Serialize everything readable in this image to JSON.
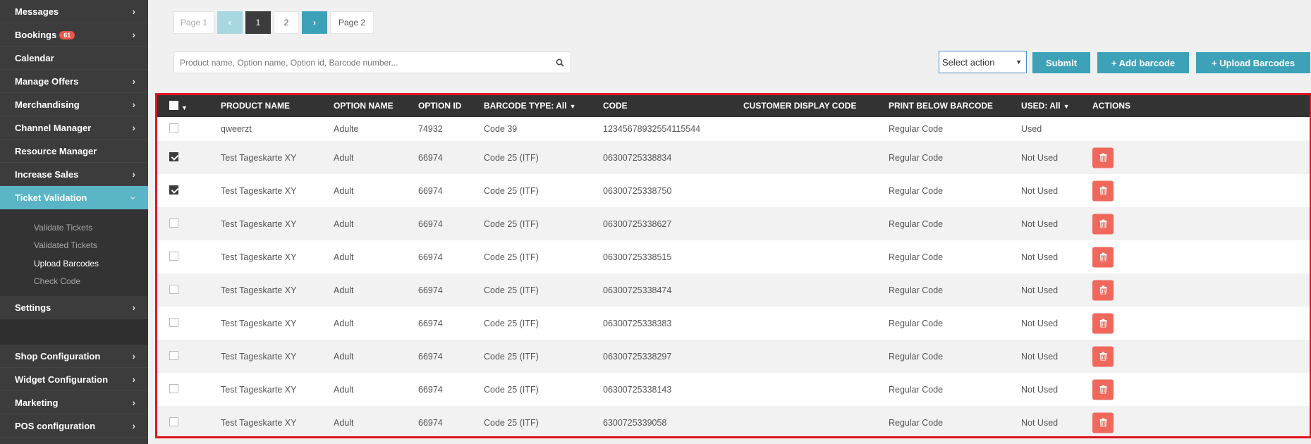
{
  "sidebar": {
    "items_top": [
      {
        "label": "Messages",
        "chevron": true
      },
      {
        "label": "Bookings",
        "badge": "61",
        "chevron": true
      },
      {
        "label": "Calendar",
        "chevron": false
      },
      {
        "label": "Manage Offers",
        "chevron": true
      },
      {
        "label": "Merchandising",
        "chevron": true
      },
      {
        "label": "Channel Manager",
        "chevron": true
      },
      {
        "label": "Resource Manager",
        "chevron": false
      },
      {
        "label": "Increase Sales",
        "chevron": true
      }
    ],
    "active": {
      "label": "Ticket Validation"
    },
    "sub_items": [
      "Validate Tickets",
      "Validated Tickets",
      "Upload Barcodes",
      "Check Code"
    ],
    "settings": {
      "label": "Settings"
    },
    "items_bottom": [
      "Shop Configuration",
      "Widget Configuration",
      "Marketing",
      "POS configuration"
    ]
  },
  "pagination": {
    "first_label": "Page 1",
    "prev": "‹",
    "page1": "1",
    "page2": "2",
    "next": "›",
    "last_label": "Page 2"
  },
  "search": {
    "placeholder": "Product name, Option name, Option id, Barcode number..."
  },
  "toolbar": {
    "select_action": "Select action",
    "submit": "Submit",
    "add_barcode": "+ Add barcode",
    "upload_barcodes": "+ Upload Barcodes"
  },
  "table": {
    "headers": {
      "product_name": "PRODUCT NAME",
      "option_name": "OPTION NAME",
      "option_id": "OPTION ID",
      "barcode_type": "BARCODE TYPE: All",
      "code": "CODE",
      "customer_display_code": "CUSTOMER DISPLAY CODE",
      "print_below": "PRINT BELOW BARCODE",
      "used": "USED: All",
      "actions": "ACTIONS"
    },
    "rows": [
      {
        "checked": false,
        "product": "qweerzt",
        "option": "Adulte",
        "option_id": "74932",
        "type": "Code 39",
        "code": "12345678932554115544",
        "customer_code": "",
        "print_below": "Regular Code",
        "used": "Used",
        "deletable": false
      },
      {
        "checked": true,
        "product": "Test Tageskarte XY",
        "option": "Adult",
        "option_id": "66974",
        "type": "Code 25 (ITF)",
        "code": "06300725338834",
        "customer_code": "",
        "print_below": "Regular Code",
        "used": "Not Used",
        "deletable": true
      },
      {
        "checked": true,
        "product": "Test Tageskarte XY",
        "option": "Adult",
        "option_id": "66974",
        "type": "Code 25 (ITF)",
        "code": "06300725338750",
        "customer_code": "",
        "print_below": "Regular Code",
        "used": "Not Used",
        "deletable": true
      },
      {
        "checked": false,
        "product": "Test Tageskarte XY",
        "option": "Adult",
        "option_id": "66974",
        "type": "Code 25 (ITF)",
        "code": "06300725338627",
        "customer_code": "",
        "print_below": "Regular Code",
        "used": "Not Used",
        "deletable": true
      },
      {
        "checked": false,
        "product": "Test Tageskarte XY",
        "option": "Adult",
        "option_id": "66974",
        "type": "Code 25 (ITF)",
        "code": "06300725338515",
        "customer_code": "",
        "print_below": "Regular Code",
        "used": "Not Used",
        "deletable": true
      },
      {
        "checked": false,
        "product": "Test Tageskarte XY",
        "option": "Adult",
        "option_id": "66974",
        "type": "Code 25 (ITF)",
        "code": "06300725338474",
        "customer_code": "",
        "print_below": "Regular Code",
        "used": "Not Used",
        "deletable": true
      },
      {
        "checked": false,
        "product": "Test Tageskarte XY",
        "option": "Adult",
        "option_id": "66974",
        "type": "Code 25 (ITF)",
        "code": "06300725338383",
        "customer_code": "",
        "print_below": "Regular Code",
        "used": "Not Used",
        "deletable": true
      },
      {
        "checked": false,
        "product": "Test Tageskarte XY",
        "option": "Adult",
        "option_id": "66974",
        "type": "Code 25 (ITF)",
        "code": "06300725338297",
        "customer_code": "",
        "print_below": "Regular Code",
        "used": "Not Used",
        "deletable": true
      },
      {
        "checked": false,
        "product": "Test Tageskarte XY",
        "option": "Adult",
        "option_id": "66974",
        "type": "Code 25 (ITF)",
        "code": "06300725338143",
        "customer_code": "",
        "print_below": "Regular Code",
        "used": "Not Used",
        "deletable": true
      },
      {
        "checked": false,
        "product": "Test Tageskarte XY",
        "option": "Adult",
        "option_id": "66974",
        "type": "Code 25 (ITF)",
        "code": "6300725339058",
        "customer_code": "",
        "print_below": "Regular Code",
        "used": "Not Used",
        "deletable": true
      }
    ]
  },
  "colors": {
    "sidebar_bg": "#3c3c3c",
    "accent": "#3da2b8",
    "active_nav": "#5ab6c6",
    "delete": "#f0675b",
    "highlight_border": "#e0141f",
    "badge": "#e8584b"
  }
}
